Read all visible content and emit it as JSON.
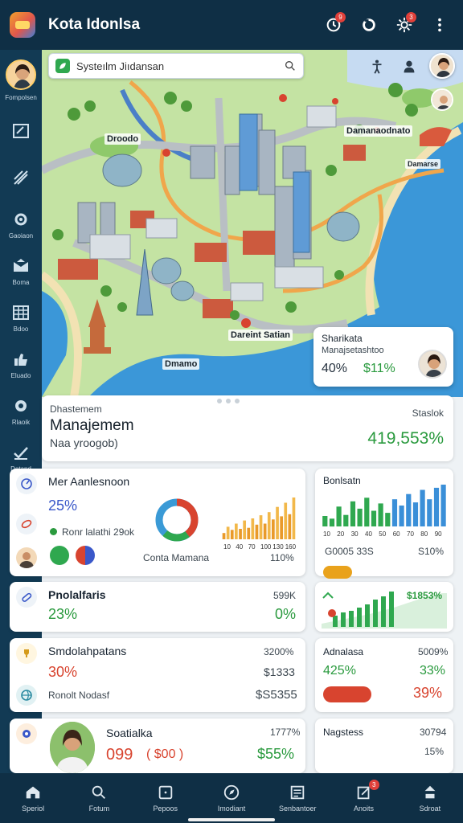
{
  "header": {
    "title": "Kota Idonlsa",
    "badges": {
      "clock": "9",
      "settings": "3"
    }
  },
  "sidebar": {
    "user_label": "Fompolsen",
    "items": [
      {
        "icon": "edit-box-icon",
        "label": ""
      },
      {
        "icon": "pencil-lines-icon",
        "label": ""
      },
      {
        "icon": "gear-icon",
        "label": "Gaoiaon"
      },
      {
        "icon": "mail-icon",
        "label": "Boma"
      },
      {
        "icon": "grid-table-icon",
        "label": "Bdoo"
      },
      {
        "icon": "thumbs-up-icon",
        "label": "Eluado"
      },
      {
        "icon": "settings-icon",
        "label": "Rlaoik"
      },
      {
        "icon": "check-pen-icon",
        "label": "Datand"
      }
    ]
  },
  "map": {
    "search_value": "Systeılm Jiıdansan",
    "labels": {
      "north": "Droodo",
      "east": "Damanaodnato",
      "market": "Damarse",
      "bottom": "Dmamo",
      "centre": "Dareint Satian"
    },
    "card": {
      "title": "Sharikata",
      "subtitle": "Manajsetashtoo",
      "left_value": "40%",
      "right_value": "$11%"
    }
  },
  "sheet": {
    "overline": "Dhastemem",
    "title": "Manajemem",
    "subtitle": "Naa yroogob)",
    "right_label": "Staslok",
    "right_value": "419,553%"
  },
  "cards": {
    "overview": {
      "title": "Mer Aanlesnoon",
      "value": "25%",
      "legend": "Ronr lalathi 29ok",
      "donut_label": "Conta Mamana",
      "bar_pct": "110%"
    },
    "bars_card": {
      "title": "Bonlsatn",
      "label": "G0005 33S",
      "pct": "S10%"
    },
    "progress_card": {
      "title": "Pnolalfaris",
      "value": "23%",
      "right_label": "599K",
      "right_value": "0%"
    },
    "growth_card": {
      "pill": "",
      "value": "$1853%"
    },
    "sales_card": {
      "title": "Smdolahpatans",
      "value": "30%",
      "right_top": "3200%",
      "right_mid": "$1333",
      "row_label": "Ronolt Nodasf",
      "row_value": "$S5355"
    },
    "admin_card": {
      "title": "Adnalasa",
      "right_top": "5009%",
      "value": "425%",
      "right_value": "33%",
      "pill": "",
      "pill_value": "39%"
    },
    "profile_card": {
      "title": "Soatialka",
      "value": "099",
      "value_paren": "( $00 )",
      "right_top": "1777%",
      "right_value": "$55%"
    },
    "progress2_card": {
      "title": "Nagstess",
      "right_top": "30794",
      "right_value": "15%"
    }
  },
  "chart_data": [
    {
      "type": "bar",
      "categories": [
        "10",
        "20",
        "30",
        "40",
        "50",
        "60",
        "70",
        "80",
        "90",
        "100",
        "110",
        "120",
        "130",
        "140",
        "150",
        "160",
        "170",
        "180"
      ],
      "series": [
        {
          "values": [
            12,
            24,
            18,
            30,
            20,
            36,
            22,
            40,
            28,
            46,
            30,
            52,
            38,
            62,
            44,
            70,
            48,
            80
          ]
        }
      ]
    },
    {
      "type": "bar",
      "categories": [
        "10",
        "20",
        "30",
        "40",
        "50",
        "60",
        "70",
        "80",
        "90"
      ],
      "series": [
        {
          "values": [
            20,
            15,
            38,
            22,
            48,
            34,
            55,
            30,
            44,
            26,
            52,
            40,
            62,
            46,
            70,
            52,
            74,
            80
          ]
        }
      ]
    }
  ],
  "bottom_nav": [
    {
      "icon": "home-icon",
      "label": "Speriol"
    },
    {
      "icon": "search-icon",
      "label": "Fotum"
    },
    {
      "icon": "square-icon",
      "label": "Pepoos"
    },
    {
      "icon": "compass-icon",
      "label": "Imodiant"
    },
    {
      "icon": "document-icon",
      "label": "Senbantoer"
    },
    {
      "icon": "edit-icon",
      "label": "Anoits",
      "badge": "3"
    },
    {
      "icon": "person-icon",
      "label": "Sdroat"
    }
  ]
}
